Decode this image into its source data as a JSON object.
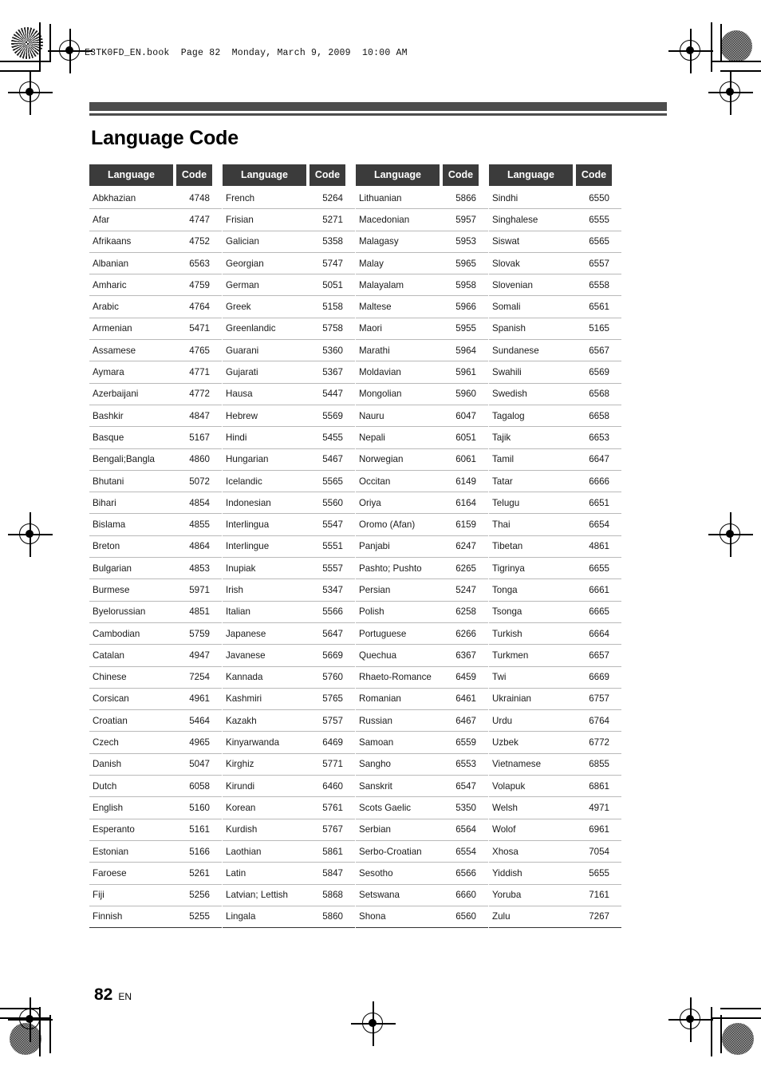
{
  "book_header": "E3TK0FD_EN.book  Page 82  Monday, March 9, 2009  10:00 AM",
  "page_title": "Language Code",
  "footer": {
    "page_number": "82",
    "language_code": "EN"
  },
  "table": {
    "headers": {
      "language": "Language",
      "code": "Code"
    },
    "columns": [
      {
        "rows": [
          {
            "language": "Abkhazian",
            "code": "4748"
          },
          {
            "language": "Afar",
            "code": "4747"
          },
          {
            "language": "Afrikaans",
            "code": "4752"
          },
          {
            "language": "Albanian",
            "code": "6563"
          },
          {
            "language": "Amharic",
            "code": "4759"
          },
          {
            "language": "Arabic",
            "code": "4764"
          },
          {
            "language": "Armenian",
            "code": "5471"
          },
          {
            "language": "Assamese",
            "code": "4765"
          },
          {
            "language": "Aymara",
            "code": "4771"
          },
          {
            "language": "Azerbaijani",
            "code": "4772"
          },
          {
            "language": "Bashkir",
            "code": "4847"
          },
          {
            "language": "Basque",
            "code": "5167"
          },
          {
            "language": "Bengali;Bangla",
            "code": "4860"
          },
          {
            "language": "Bhutani",
            "code": "5072"
          },
          {
            "language": "Bihari",
            "code": "4854"
          },
          {
            "language": "Bislama",
            "code": "4855"
          },
          {
            "language": "Breton",
            "code": "4864"
          },
          {
            "language": "Bulgarian",
            "code": "4853"
          },
          {
            "language": "Burmese",
            "code": "5971"
          },
          {
            "language": "Byelorussian",
            "code": "4851"
          },
          {
            "language": "Cambodian",
            "code": "5759"
          },
          {
            "language": "Catalan",
            "code": "4947"
          },
          {
            "language": "Chinese",
            "code": "7254"
          },
          {
            "language": "Corsican",
            "code": "4961"
          },
          {
            "language": "Croatian",
            "code": "5464"
          },
          {
            "language": "Czech",
            "code": "4965"
          },
          {
            "language": "Danish",
            "code": "5047"
          },
          {
            "language": "Dutch",
            "code": "6058"
          },
          {
            "language": "English",
            "code": "5160"
          },
          {
            "language": "Esperanto",
            "code": "5161"
          },
          {
            "language": "Estonian",
            "code": "5166"
          },
          {
            "language": "Faroese",
            "code": "5261"
          },
          {
            "language": "Fiji",
            "code": "5256"
          },
          {
            "language": "Finnish",
            "code": "5255"
          }
        ]
      },
      {
        "rows": [
          {
            "language": "French",
            "code": "5264"
          },
          {
            "language": "Frisian",
            "code": "5271"
          },
          {
            "language": "Galician",
            "code": "5358"
          },
          {
            "language": "Georgian",
            "code": "5747"
          },
          {
            "language": "German",
            "code": "5051"
          },
          {
            "language": "Greek",
            "code": "5158"
          },
          {
            "language": "Greenlandic",
            "code": "5758"
          },
          {
            "language": "Guarani",
            "code": "5360"
          },
          {
            "language": "Gujarati",
            "code": "5367"
          },
          {
            "language": "Hausa",
            "code": "5447"
          },
          {
            "language": "Hebrew",
            "code": "5569"
          },
          {
            "language": "Hindi",
            "code": "5455"
          },
          {
            "language": "Hungarian",
            "code": "5467"
          },
          {
            "language": "Icelandic",
            "code": "5565"
          },
          {
            "language": "Indonesian",
            "code": "5560"
          },
          {
            "language": "Interlingua",
            "code": "5547"
          },
          {
            "language": "Interlingue",
            "code": "5551"
          },
          {
            "language": "Inupiak",
            "code": "5557"
          },
          {
            "language": "Irish",
            "code": "5347"
          },
          {
            "language": "Italian",
            "code": "5566"
          },
          {
            "language": "Japanese",
            "code": "5647"
          },
          {
            "language": "Javanese",
            "code": "5669"
          },
          {
            "language": "Kannada",
            "code": "5760"
          },
          {
            "language": "Kashmiri",
            "code": "5765"
          },
          {
            "language": "Kazakh",
            "code": "5757"
          },
          {
            "language": "Kinyarwanda",
            "code": "6469"
          },
          {
            "language": "Kirghiz",
            "code": "5771"
          },
          {
            "language": "Kirundi",
            "code": "6460"
          },
          {
            "language": "Korean",
            "code": "5761"
          },
          {
            "language": "Kurdish",
            "code": "5767"
          },
          {
            "language": "Laothian",
            "code": "5861"
          },
          {
            "language": "Latin",
            "code": "5847"
          },
          {
            "language": "Latvian; Lettish",
            "code": "5868"
          },
          {
            "language": "Lingala",
            "code": "5860"
          }
        ]
      },
      {
        "rows": [
          {
            "language": "Lithuanian",
            "code": "5866"
          },
          {
            "language": "Macedonian",
            "code": "5957"
          },
          {
            "language": "Malagasy",
            "code": "5953"
          },
          {
            "language": "Malay",
            "code": "5965"
          },
          {
            "language": "Malayalam",
            "code": "5958"
          },
          {
            "language": "Maltese",
            "code": "5966"
          },
          {
            "language": "Maori",
            "code": "5955"
          },
          {
            "language": "Marathi",
            "code": "5964"
          },
          {
            "language": "Moldavian",
            "code": "5961"
          },
          {
            "language": "Mongolian",
            "code": "5960"
          },
          {
            "language": "Nauru",
            "code": "6047"
          },
          {
            "language": "Nepali",
            "code": "6051"
          },
          {
            "language": "Norwegian",
            "code": "6061"
          },
          {
            "language": "Occitan",
            "code": "6149"
          },
          {
            "language": "Oriya",
            "code": "6164"
          },
          {
            "language": "Oromo (Afan)",
            "code": "6159"
          },
          {
            "language": "Panjabi",
            "code": "6247"
          },
          {
            "language": "Pashto; Pushto",
            "code": "6265"
          },
          {
            "language": "Persian",
            "code": "5247"
          },
          {
            "language": "Polish",
            "code": "6258"
          },
          {
            "language": "Portuguese",
            "code": "6266"
          },
          {
            "language": "Quechua",
            "code": "6367"
          },
          {
            "language": "Rhaeto-Romance",
            "code": "6459"
          },
          {
            "language": "Romanian",
            "code": "6461"
          },
          {
            "language": "Russian",
            "code": "6467"
          },
          {
            "language": "Samoan",
            "code": "6559"
          },
          {
            "language": "Sangho",
            "code": "6553"
          },
          {
            "language": "Sanskrit",
            "code": "6547"
          },
          {
            "language": "Scots Gaelic",
            "code": "5350"
          },
          {
            "language": "Serbian",
            "code": "6564"
          },
          {
            "language": "Serbo-Croatian",
            "code": "6554"
          },
          {
            "language": "Sesotho",
            "code": "6566"
          },
          {
            "language": "Setswana",
            "code": "6660"
          },
          {
            "language": "Shona",
            "code": "6560"
          }
        ]
      },
      {
        "rows": [
          {
            "language": "Sindhi",
            "code": "6550"
          },
          {
            "language": "Singhalese",
            "code": "6555"
          },
          {
            "language": "Siswat",
            "code": "6565"
          },
          {
            "language": "Slovak",
            "code": "6557"
          },
          {
            "language": "Slovenian",
            "code": "6558"
          },
          {
            "language": "Somali",
            "code": "6561"
          },
          {
            "language": "Spanish",
            "code": "5165"
          },
          {
            "language": "Sundanese",
            "code": "6567"
          },
          {
            "language": "Swahili",
            "code": "6569"
          },
          {
            "language": "Swedish",
            "code": "6568"
          },
          {
            "language": "Tagalog",
            "code": "6658"
          },
          {
            "language": "Tajik",
            "code": "6653"
          },
          {
            "language": "Tamil",
            "code": "6647"
          },
          {
            "language": "Tatar",
            "code": "6666"
          },
          {
            "language": "Telugu",
            "code": "6651"
          },
          {
            "language": "Thai",
            "code": "6654"
          },
          {
            "language": "Tibetan",
            "code": "4861"
          },
          {
            "language": "Tigrinya",
            "code": "6655"
          },
          {
            "language": "Tonga",
            "code": "6661"
          },
          {
            "language": "Tsonga",
            "code": "6665"
          },
          {
            "language": "Turkish",
            "code": "6664"
          },
          {
            "language": "Turkmen",
            "code": "6657"
          },
          {
            "language": "Twi",
            "code": "6669"
          },
          {
            "language": "Ukrainian",
            "code": "6757"
          },
          {
            "language": "Urdu",
            "code": "6764"
          },
          {
            "language": "Uzbek",
            "code": "6772"
          },
          {
            "language": "Vietnamese",
            "code": "6855"
          },
          {
            "language": "Volapuk",
            "code": "6861"
          },
          {
            "language": "Welsh",
            "code": "4971"
          },
          {
            "language": "Wolof",
            "code": "6961"
          },
          {
            "language": "Xhosa",
            "code": "7054"
          },
          {
            "language": "Yiddish",
            "code": "5655"
          },
          {
            "language": "Yoruba",
            "code": "7161"
          },
          {
            "language": "Zulu",
            "code": "7267"
          }
        ]
      }
    ]
  }
}
